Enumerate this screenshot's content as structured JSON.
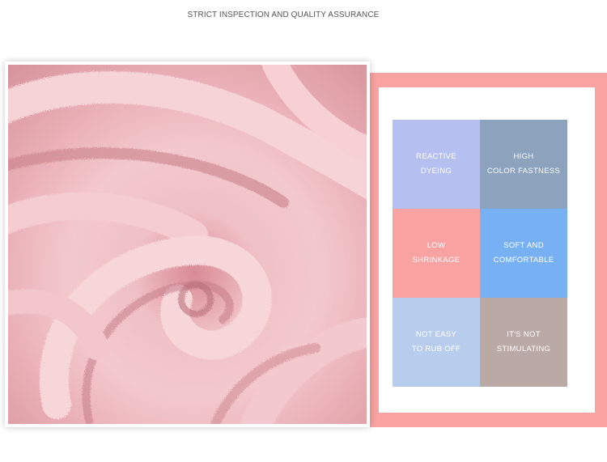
{
  "heading": "STRICT INSPECTION AND QUALITY ASSURANCE",
  "colors": {
    "frame_pink": "#f8a2a2"
  },
  "features": [
    {
      "line1": "REACTIVE",
      "line2": "DYEING",
      "color": "#b6c0f0"
    },
    {
      "line1": "HIGH",
      "line2": "COLOR FASTNESS",
      "color": "#8ca2bd"
    },
    {
      "line1": "LOW",
      "line2": "SHRINKAGE",
      "color": "#f8a2a2"
    },
    {
      "line1": "SOFT AND",
      "line2": "COMFORTABLE",
      "color": "#78b0f4"
    },
    {
      "line1": "NOT EASY",
      "line2": "TO RUB OFF",
      "color": "#b8cdee"
    },
    {
      "line1": "IT'S NOT",
      "line2": "STIMULATING",
      "color": "#bba9a5"
    }
  ]
}
